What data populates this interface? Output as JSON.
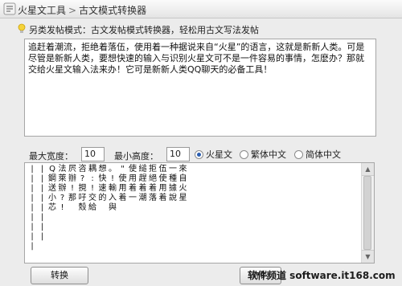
{
  "window": {
    "app_title": "火星文工具",
    "separator": ">",
    "page_title": "古文模式转换器"
  },
  "hint": {
    "text": "另类发帖模式：古文发帖模式转换器，轻松用古文写法发帖"
  },
  "input_text": "追赶着潮流，拒绝着落伍，使用着一种据说来自“火星”的语言，这就是新新人类。可是尽管是新新人类，要想快速的输入与识别火星文可不是一件容易的事情，怎麽办？那就交给火星文输入法来办！它可是新新人类QQ聊天的必备工具！",
  "options": {
    "max_width_label": "最大宽度：",
    "max_width_value": "10",
    "min_height_label": "最小高度：",
    "min_height_value": "10",
    "radios": [
      {
        "label": "火星文",
        "checked": true
      },
      {
        "label": "繁体中文",
        "checked": false
      },
      {
        "label": "简体中文",
        "checked": false
      }
    ]
  },
  "output_columns": [
    "|||||||||",
    "||||||||",
    "Q鋼送小芯",
    "法萊辦?!",
    "屄辦!那",
    "咨?挸吇殼",
    "耦:!交給",
    "想快速的",
    "。!輸入與",
    "\"使用着",
    "使用着一",
    "縋趕着潮",
    "拒絕着落",
    "伍使用着",
    "一種據說",
    "來自火星"
  ],
  "buttons": {
    "convert": "转换",
    "copy": "你的"
  },
  "watermark": "软件频道 software.it168.com"
}
